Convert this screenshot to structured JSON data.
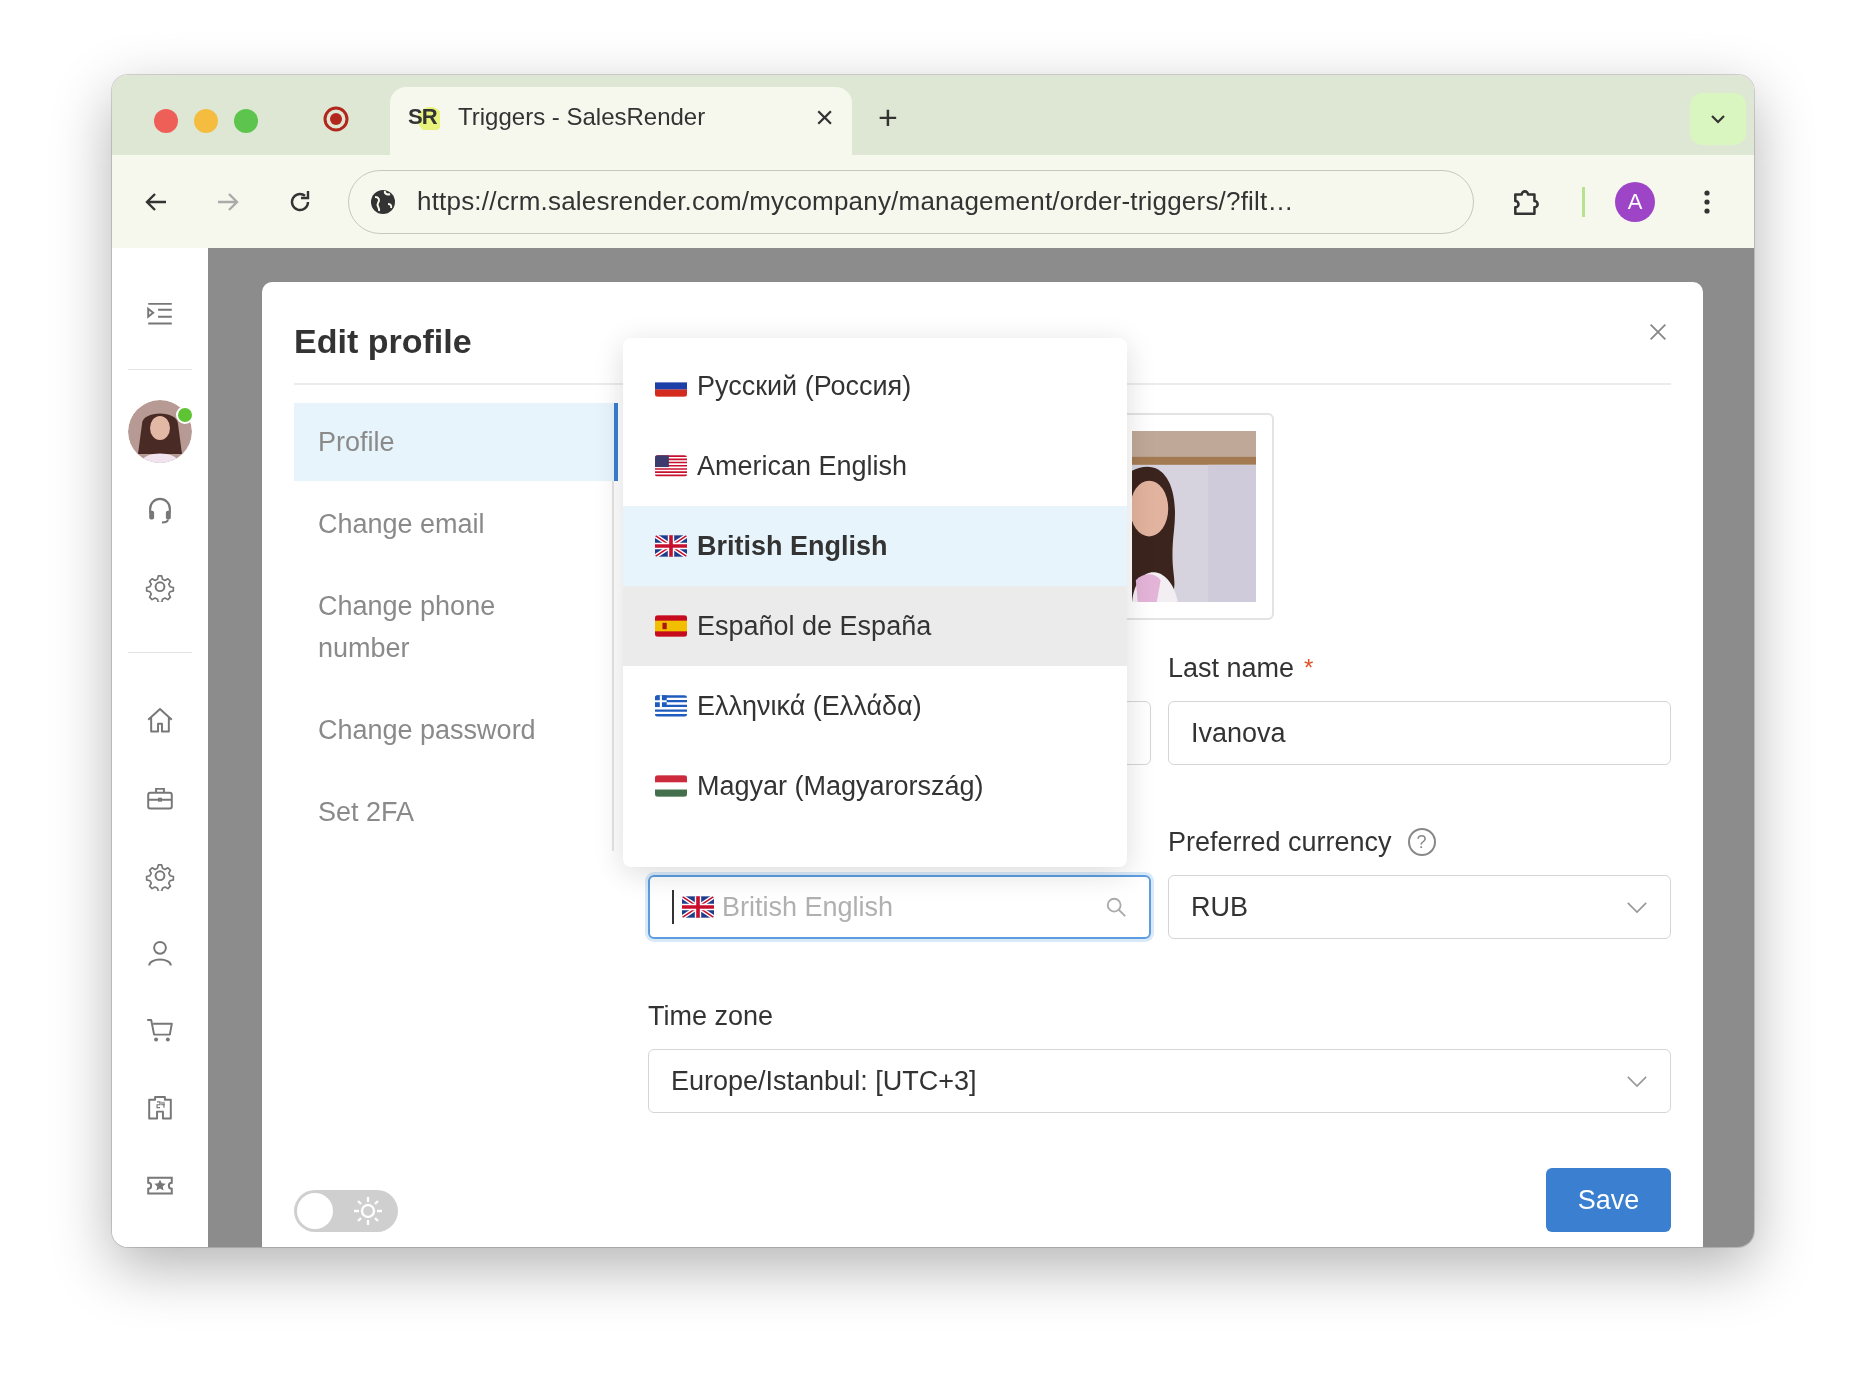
{
  "browser": {
    "tab": {
      "logo": "SR",
      "title": "Triggers - SalesRender",
      "close": "×"
    },
    "new_tab": "+",
    "forward_disabled": true,
    "url": "https://crm.salesrender.com/mycompany/management/order-triggers/?filt…",
    "profile_initial": "A"
  },
  "sidebar": {
    "user_online": true
  },
  "modal": {
    "title": "Edit profile",
    "nav": [
      {
        "label": "Profile",
        "selected": true
      },
      {
        "label": "Change email",
        "selected": false
      },
      {
        "label": "Change phone number",
        "selected": false
      },
      {
        "label": "Change password",
        "selected": false
      },
      {
        "label": "Set 2FA",
        "selected": false
      }
    ],
    "language_options": [
      {
        "label": "Русский (Россия)",
        "kind": "ru",
        "selected": false,
        "hovered": false
      },
      {
        "label": "American English",
        "kind": "us",
        "selected": false,
        "hovered": false
      },
      {
        "label": "British English",
        "kind": "gb",
        "selected": true,
        "hovered": false
      },
      {
        "label": "Español de España",
        "kind": "es",
        "selected": false,
        "hovered": true
      },
      {
        "label": "Ελληνικά (Ελλάδα)",
        "kind": "gr",
        "selected": false,
        "hovered": false
      },
      {
        "label": "Magyar (Magyarország)",
        "kind": "hu",
        "selected": false,
        "hovered": false
      }
    ],
    "language_field": {
      "placeholder": "British English",
      "kind": "gb",
      "focused": true
    },
    "last_name": {
      "label": "Last name",
      "required_mark": "*",
      "value": "Ivanova"
    },
    "currency": {
      "label": "Preferred currency",
      "help_icon": "?",
      "value": "RUB"
    },
    "time_zone": {
      "label": "Time zone",
      "value": "Europe/Istanbul: [UTC+3]"
    },
    "theme_toggle": {
      "on": false
    },
    "save": "Save"
  }
}
